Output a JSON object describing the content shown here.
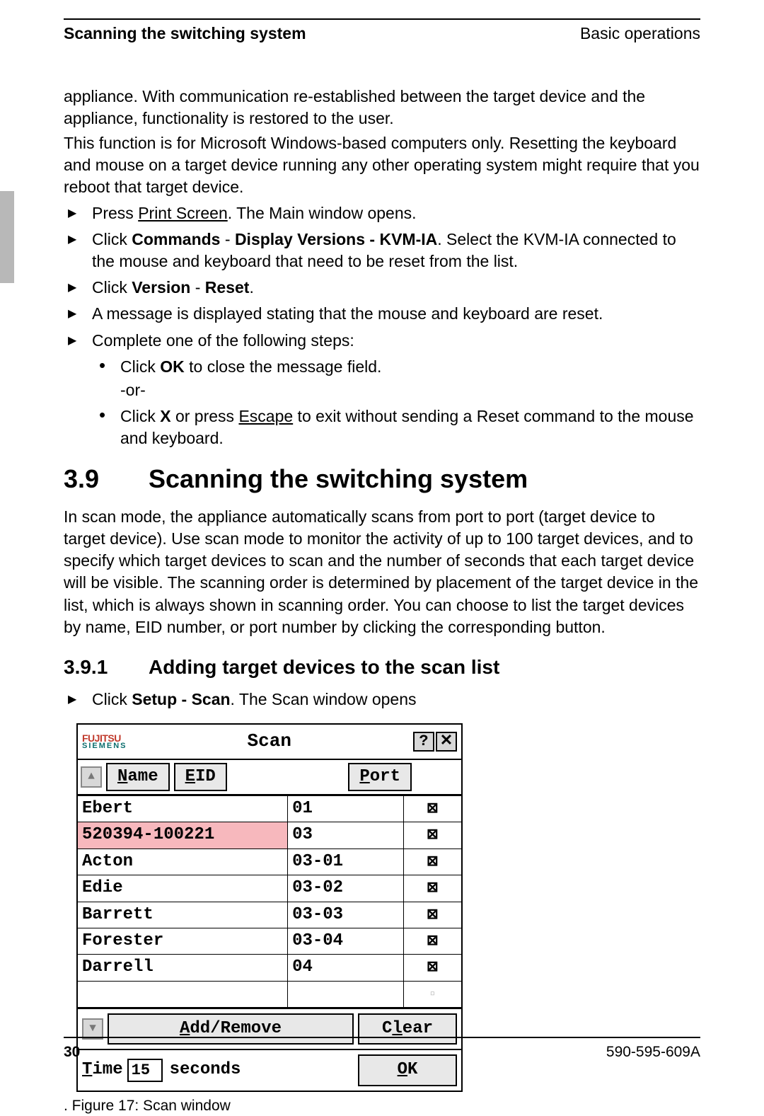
{
  "header": {
    "left": "Scanning the switching system",
    "right": "Basic operations"
  },
  "intro_paras": [
    "appliance. With communication re-established between the target device and the appliance, functionality is restored to the user.",
    "This function is for Microsoft Windows-based computers only. Resetting the keyboard and mouse on a target device running any other operating system might require that you reboot that target device."
  ],
  "steps": {
    "s1_pre": "Press ",
    "s1_u": "Print Screen",
    "s1_post": ". The Main window opens.",
    "s2_pre": "Click ",
    "s2_b": "Commands",
    "s2_mid1": " - ",
    "s2_b2": "Display Versions - KVM-IA",
    "s2_post": ". Select the KVM-IA connected to the mouse and keyboard that need to be reset from the list.",
    "s3_pre": "Click ",
    "s3_b": "Version",
    "s3_mid": " - ",
    "s3_b2": "Reset",
    "s3_post": ".",
    "s4": "A message is displayed stating that the mouse and keyboard are reset.",
    "s5": "Complete one of the following steps:",
    "sub1_pre": "Click ",
    "sub1_b": "OK",
    "sub1_post": " to close the message field.",
    "or": "-or-",
    "sub2_pre": "Click ",
    "sub2_b": "X",
    "sub2_mid": " or press ",
    "sub2_u": "Escape",
    "sub2_post": " to exit without sending a Reset command to the mouse and keyboard."
  },
  "section": {
    "num": "3.9",
    "title": "Scanning the switching system"
  },
  "section_para": "In scan mode, the appliance automatically scans from port to port (target device to target device). Use scan mode to monitor the activity of up to 100 target devices, and to specify which target devices to scan and the number of seconds that each target device will be visible. The scanning order is determined by placement of the target device in the list, which is always shown in scanning order. You can choose to list the target devices by name, EID number, or port number by clicking the corresponding button.",
  "subsection": {
    "num": "3.9.1",
    "title": "Adding target devices to the scan list"
  },
  "sub_step_pre": "Click ",
  "sub_step_b": "Setup - Scan",
  "sub_step_post": ". The Scan window opens",
  "scan_window": {
    "logo1": "FUJITSU",
    "logo2": "SIEMENS",
    "title": "Scan",
    "help": "?",
    "close": "✕",
    "col_name_u": "N",
    "col_name_rest": "ame",
    "col_eid_u": "E",
    "col_eid_rest": "ID",
    "col_port_u": "P",
    "col_port_rest": "ort",
    "rows": [
      {
        "name": "Ebert",
        "port": "01",
        "checked": true,
        "highlight": false
      },
      {
        "name": "520394-100221",
        "port": "03",
        "checked": true,
        "highlight": true
      },
      {
        "name": "Acton",
        "port": "03-01",
        "checked": true,
        "highlight": false
      },
      {
        "name": "Edie",
        "port": "03-02",
        "checked": true,
        "highlight": false
      },
      {
        "name": "Barrett",
        "port": "03-03",
        "checked": true,
        "highlight": false
      },
      {
        "name": "Forester",
        "port": "03-04",
        "checked": true,
        "highlight": false
      },
      {
        "name": "Darrell",
        "port": "04",
        "checked": true,
        "highlight": false
      },
      {
        "name": "",
        "port": "",
        "checked": false,
        "highlight": false
      }
    ],
    "addremove_u": "A",
    "addremove_rest": "dd/Remove",
    "clear_pre": "C",
    "clear_u": "l",
    "clear_post": "ear",
    "time_u": "T",
    "time_rest": "ime",
    "time_value": "15",
    "seconds": "seconds",
    "ok_u": "O",
    "ok_rest": "K"
  },
  "figure_caption": "Figure 17: Scan window",
  "footer": {
    "page": "30",
    "doc": "590-595-609A"
  }
}
